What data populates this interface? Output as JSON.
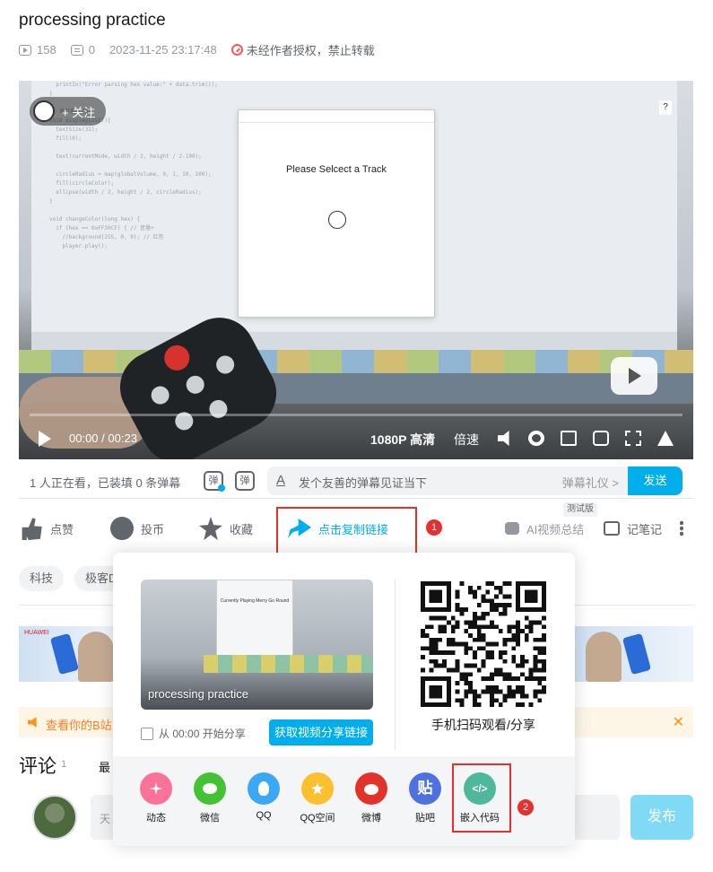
{
  "video": {
    "title": "processing practice",
    "play_count": "158",
    "danmaku_count": "0",
    "publish_time": "2023-11-25 23:17:48",
    "copyright_notice": "未经作者授权，禁止转载"
  },
  "player": {
    "follow_label": "+ 关注",
    "help_label": "?",
    "screen_text": "Please Selcect a Track",
    "time_current": "00:00",
    "time_total": "00:23",
    "time_sep": " / ",
    "quality": "1080P 高清",
    "speed": "倍速",
    "progress": 0.0
  },
  "danmaku": {
    "watching": "1 人正在看，已装填 0 条弹幕",
    "toggle_icon_a": "弹",
    "toggle_icon_b": "弹",
    "input_prefix": "A",
    "placeholder": "发个友善的弹幕见证当下",
    "etiquette": "弹幕礼仪 >",
    "send": "发送"
  },
  "toolbar": {
    "like": "点赞",
    "coin": "投币",
    "favorite": "收藏",
    "share": "点击复制链接",
    "ai_summary": "AI视频总结",
    "ai_tag": "测试版",
    "note": "记笔记",
    "annotation_1": "1",
    "annotation_2": "2"
  },
  "tags": [
    "科技",
    "极客D"
  ],
  "ad": {
    "brand": "HUAWEI"
  },
  "notice": {
    "text": "查看你的B站",
    "close": "✕"
  },
  "comments": {
    "title": "评论",
    "count": "1",
    "sort": "最",
    "placeholder": "天",
    "send": "发布"
  },
  "share_popup": {
    "thumb_caption": "processing practice",
    "thumb_screen_text": "Currently Playing Merry Go Round",
    "start_option": "从 00:00 开始分享",
    "get_link": "获取视频分享链接",
    "qr_caption": "手机扫码观看/分享",
    "targets": [
      "动态",
      "微信",
      "QQ",
      "QQ空间",
      "微博",
      "贴吧",
      "嵌入代码"
    ],
    "target_glyphs": {
      "tieba": "贴",
      "embed": "</>"
    }
  },
  "colors": {
    "accent": "#00aeec",
    "annotation_red": "#e5302d",
    "notice_orange": "#ff7f24"
  }
}
